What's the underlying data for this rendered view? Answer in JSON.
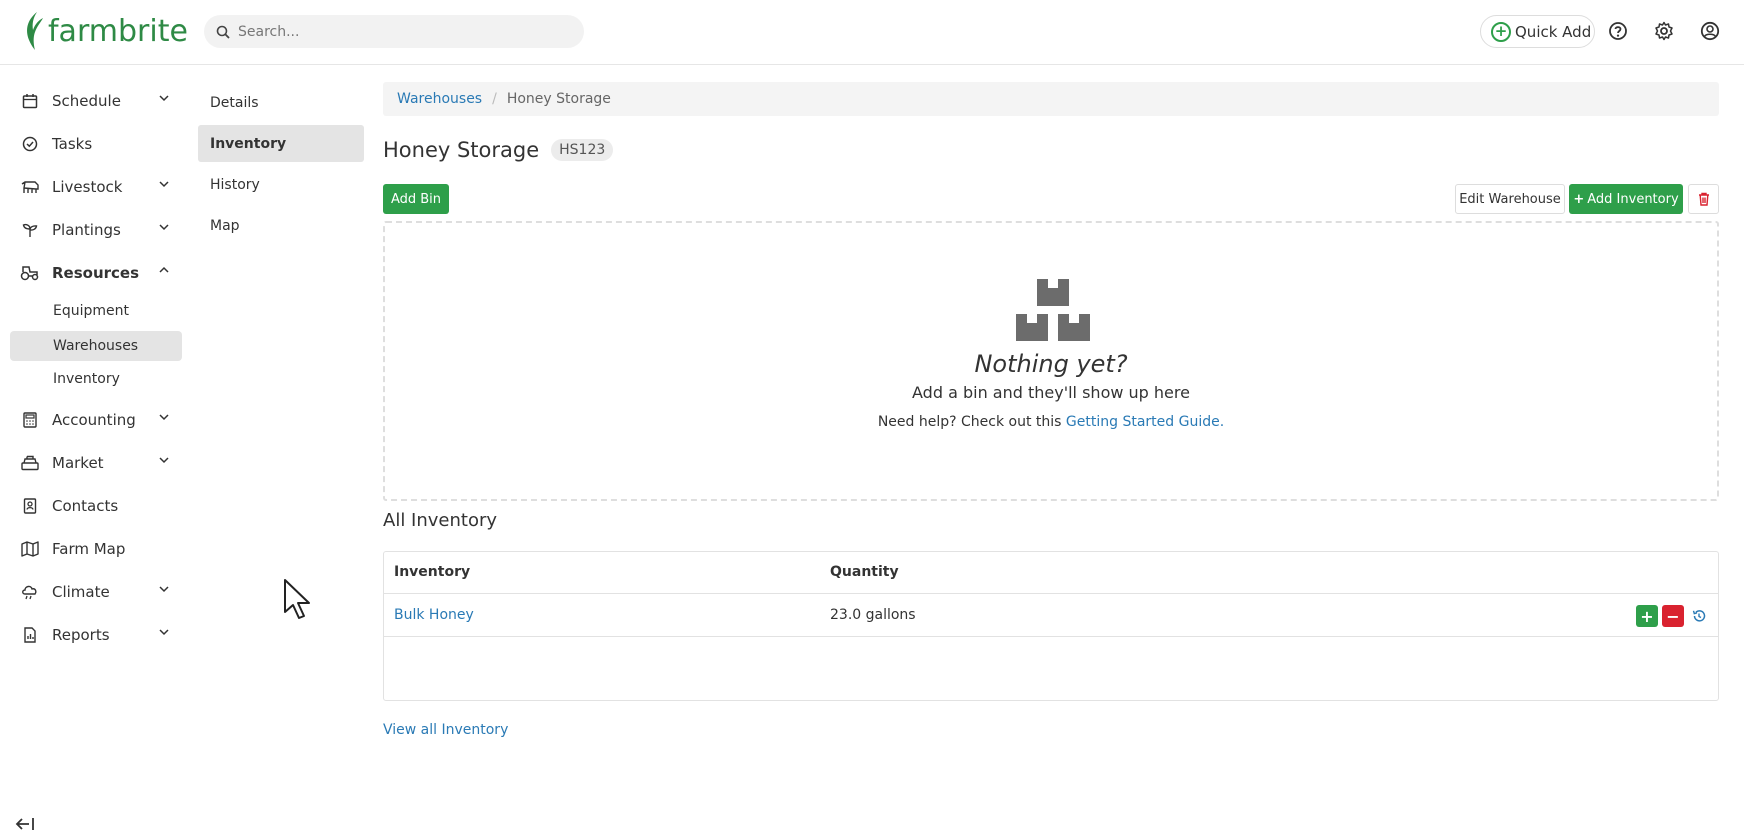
{
  "brand": {
    "name": "farmbrite"
  },
  "search": {
    "placeholder": "Search..."
  },
  "header": {
    "quick_add_label": "Quick Add",
    "icons": [
      "help-icon",
      "gear-icon",
      "user-icon"
    ]
  },
  "sidebar": {
    "items": [
      {
        "label": "Schedule",
        "icon": "calendar-icon",
        "expandable": true
      },
      {
        "label": "Tasks",
        "icon": "check-circle-icon",
        "expandable": false
      },
      {
        "label": "Livestock",
        "icon": "cow-icon",
        "expandable": true
      },
      {
        "label": "Plantings",
        "icon": "sprout-icon",
        "expandable": true
      },
      {
        "label": "Resources",
        "icon": "tractor-icon",
        "expandable": true,
        "expanded": true
      },
      {
        "label": "Accounting",
        "icon": "calculator-icon",
        "expandable": true
      },
      {
        "label": "Market",
        "icon": "cash-register-icon",
        "expandable": true
      },
      {
        "label": "Contacts",
        "icon": "address-book-icon",
        "expandable": false
      },
      {
        "label": "Farm Map",
        "icon": "map-icon",
        "expandable": false
      },
      {
        "label": "Climate",
        "icon": "cloud-rain-icon",
        "expandable": true
      },
      {
        "label": "Reports",
        "icon": "report-icon",
        "expandable": true
      }
    ],
    "resources_sub": [
      {
        "label": "Equipment",
        "active": false
      },
      {
        "label": "Warehouses",
        "active": true
      },
      {
        "label": "Inventory",
        "active": false
      }
    ]
  },
  "subnav": {
    "items": [
      {
        "label": "Details",
        "active": false
      },
      {
        "label": "Inventory",
        "active": true
      },
      {
        "label": "History",
        "active": false
      },
      {
        "label": "Map",
        "active": false
      }
    ]
  },
  "breadcrumb": {
    "parent": "Warehouses",
    "current": "Honey Storage"
  },
  "page": {
    "title": "Honey Storage",
    "code": "HS123"
  },
  "actions": {
    "add_bin": "Add Bin",
    "edit_warehouse": "Edit Warehouse",
    "add_inventory": "Add Inventory"
  },
  "empty_state": {
    "title": "Nothing yet?",
    "subtitle": "Add a bin and they'll show up here",
    "help_prefix": "Need help? Check out this ",
    "help_link": "Getting Started Guide."
  },
  "inventory_section": {
    "title": "All Inventory",
    "columns": [
      "Inventory",
      "Quantity"
    ],
    "rows": [
      {
        "name": "Bulk Honey",
        "quantity": "23.0 gallons"
      }
    ],
    "view_all": "View all Inventory"
  },
  "colors": {
    "brand_green": "#2e8a45",
    "button_green": "#2e9f4a",
    "danger_red": "#d9222f",
    "link_blue": "#2a7ab5"
  }
}
